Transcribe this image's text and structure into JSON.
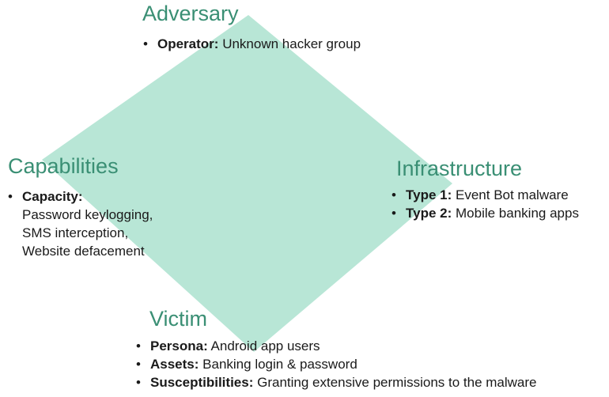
{
  "colors": {
    "diamond_fill": "#b8e6d6",
    "title_color": "#3a8f74",
    "text_color": "#1a1a1a"
  },
  "adversary": {
    "title": "Adversary",
    "items": [
      {
        "term": "Operator:",
        "text": "Unknown hacker group"
      }
    ]
  },
  "capabilities": {
    "title": "Capabilities",
    "items": [
      {
        "term": "Capacity:",
        "lines": [
          "Password keylogging,",
          "SMS interception,",
          "Website defacement"
        ]
      }
    ]
  },
  "infrastructure": {
    "title": "Infrastructure",
    "items": [
      {
        "term": "Type 1:",
        "text": "Event Bot malware"
      },
      {
        "term": "Type 2:",
        "text": "Mobile banking apps"
      }
    ]
  },
  "victim": {
    "title": "Victim",
    "items": [
      {
        "term": "Persona:",
        "text": "Android app users"
      },
      {
        "term": "Assets:",
        "text": "Banking login & password"
      },
      {
        "term": "Susceptibilities:",
        "text": "Granting extensive permissions to the malware"
      }
    ]
  }
}
